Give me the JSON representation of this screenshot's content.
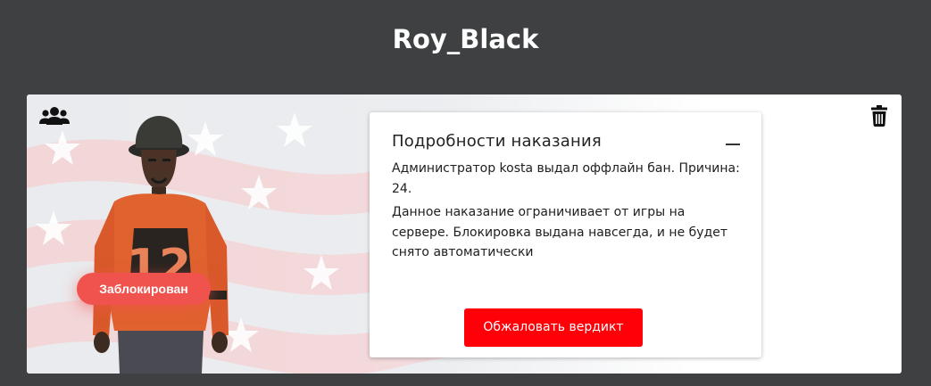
{
  "page": {
    "title": "Roy_Black"
  },
  "profile": {
    "status": "Заблокирован",
    "icons": {
      "group": "users-group-icon",
      "delete": "trash-icon"
    }
  },
  "punishment": {
    "heading": "Подробности наказания",
    "description": "Администратор kosta выдал оффлайн бан. Причина: 24.",
    "details": "Данное наказание ограничивает от игры на сервере. Блокировка выдана навсегда, и не будет снято автоматически",
    "appeal_label": "Обжаловать вердикт"
  },
  "colors": {
    "background": "#3f4042",
    "status_badge": "#f0524d",
    "appeal_button": "#ff0008"
  }
}
